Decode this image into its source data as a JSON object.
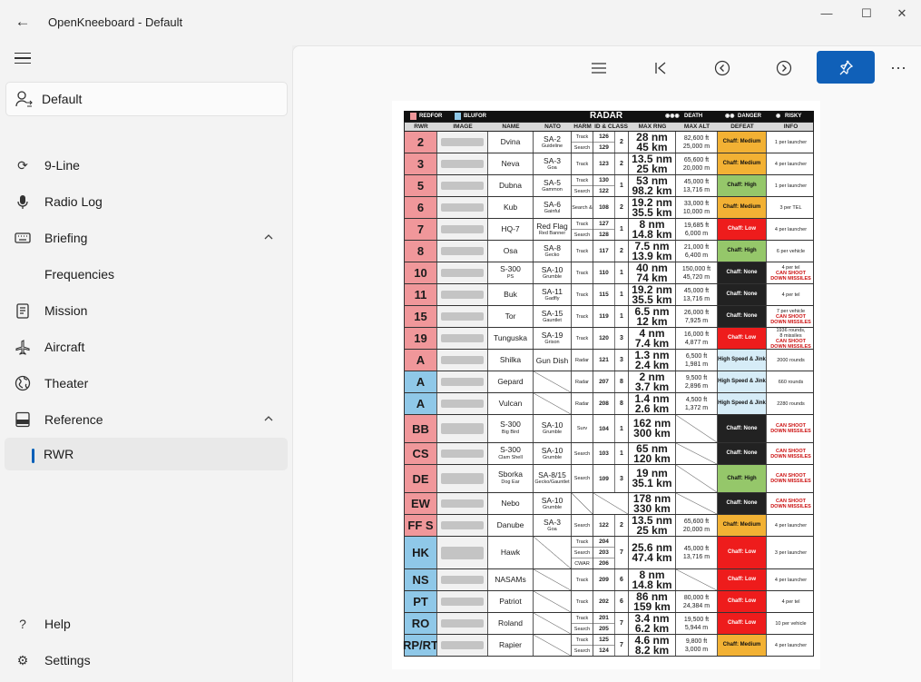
{
  "window": {
    "title": "OpenKneeboard - Default",
    "minimize": "—",
    "maximize": "☐",
    "close": "✕"
  },
  "sidebar": {
    "profile": "Default",
    "items": [
      {
        "label": "9-Line",
        "icon": "refresh-icon"
      },
      {
        "label": "Radio Log",
        "icon": "microphone-icon"
      },
      {
        "label": "Briefing",
        "icon": "keyboard-icon"
      },
      {
        "label": "Frequencies",
        "icon": ""
      },
      {
        "label": "Mission",
        "icon": "clipboard-icon"
      },
      {
        "label": "Aircraft",
        "icon": "airplane-icon"
      },
      {
        "label": "Theater",
        "icon": "globe-icon"
      },
      {
        "label": "Reference",
        "icon": "pdf-icon"
      },
      {
        "label": "RWR",
        "icon": ""
      }
    ],
    "help": "Help",
    "settings": "Settings"
  },
  "toolbar": {
    "more": "···"
  },
  "chart": {
    "title": "RADAR",
    "legend": {
      "redfor": "REDFOR",
      "blufor": "BLUFOR",
      "death": "DEATH",
      "danger": "DANGER",
      "risky": "RISKY"
    },
    "columns": [
      "RWR",
      "IMAGE",
      "NAME",
      "NATO",
      "HARM",
      "ID & CLASS",
      "MAX RNG",
      "MAX ALT",
      "DEFEAT",
      "INFO"
    ],
    "colors": {
      "redfor": "#f0979a",
      "blufor": "#8fc8e8",
      "chaff_medium": "#f2b134",
      "chaff_high": "#95c76a",
      "chaff_low": "#ee1c1c",
      "chaff_none": "#222222",
      "high_speed": "#d6ecf7"
    },
    "rows": [
      {
        "rwr": "2",
        "side": "r",
        "name": "Dvina",
        "name2": "",
        "nato": "SA-2",
        "nato2": "Guideline",
        "modes": [
          "Track",
          "Search"
        ],
        "ids": [
          "126",
          "129"
        ],
        "cls": "2",
        "rng": [
          "28 nm",
          "45 km"
        ],
        "alt": [
          "82,600 ft",
          "25,000 m"
        ],
        "defeat": "Chaff: Medium",
        "dk": "chaff_medium",
        "info": [
          "1 per launcher"
        ],
        "infored": []
      },
      {
        "rwr": "3",
        "side": "r",
        "name": "Neva",
        "name2": "",
        "nato": "SA-3",
        "nato2": "Goa",
        "modes": [
          "Track"
        ],
        "ids": [
          "123"
        ],
        "cls": "2",
        "rng": [
          "13.5 nm",
          "25 km"
        ],
        "alt": [
          "65,600 ft",
          "20,000 m"
        ],
        "defeat": "Chaff: Medium",
        "dk": "chaff_medium",
        "info": [
          "4 per launcher"
        ],
        "infored": []
      },
      {
        "rwr": "5",
        "side": "r",
        "name": "Dubna",
        "name2": "",
        "nato": "SA-5",
        "nato2": "Gammon",
        "modes": [
          "Track",
          "Search"
        ],
        "ids": [
          "130",
          "122"
        ],
        "cls": "1",
        "rng": [
          "53 nm",
          "98.2 km"
        ],
        "alt": [
          "45,000 ft",
          "13,716 m"
        ],
        "defeat": "Chaff: High",
        "dk": "chaff_high",
        "info": [
          "1 per launcher"
        ],
        "infored": []
      },
      {
        "rwr": "6",
        "side": "r",
        "name": "Kub",
        "name2": "",
        "nato": "SA-6",
        "nato2": "Gainful",
        "modes": [
          "Search & Track"
        ],
        "ids": [
          "108"
        ],
        "cls": "2",
        "rng": [
          "19.2 nm",
          "35.5 km"
        ],
        "alt": [
          "33,000 ft",
          "10,000 m"
        ],
        "defeat": "Chaff: Medium",
        "dk": "chaff_medium",
        "info": [
          "3 per TEL"
        ],
        "infored": []
      },
      {
        "rwr": "7",
        "side": "r",
        "name": "HQ-7",
        "name2": "",
        "nato": "Red Flag",
        "nato2": "Red Banner",
        "modes": [
          "Track",
          "Search"
        ],
        "ids": [
          "127",
          "128"
        ],
        "cls": "1",
        "rng": [
          "8 nm",
          "14.8 km"
        ],
        "alt": [
          "19,685 ft",
          "6,000 m"
        ],
        "defeat": "Chaff: Low",
        "dk": "chaff_low",
        "info": [
          "4 per launcher"
        ],
        "infored": []
      },
      {
        "rwr": "8",
        "side": "r",
        "name": "Osa",
        "name2": "",
        "nato": "SA-8",
        "nato2": "Gecko",
        "modes": [
          "Track"
        ],
        "ids": [
          "117"
        ],
        "cls": "2",
        "rng": [
          "7.5 nm",
          "13.9 km"
        ],
        "alt": [
          "21,000 ft",
          "6,400 m"
        ],
        "defeat": "Chaff: High",
        "dk": "chaff_high",
        "info": [
          "6 per vehicle"
        ],
        "infored": []
      },
      {
        "rwr": "10",
        "side": "r",
        "name": "S-300",
        "name2": "PS",
        "nato": "SA-10",
        "nato2": "Grumble",
        "modes": [
          "Track"
        ],
        "ids": [
          "110"
        ],
        "cls": "1",
        "rng": [
          "40 nm",
          "74 km"
        ],
        "alt": [
          "150,000 ft",
          "45,720 m"
        ],
        "defeat": "Chaff: None",
        "dk": "chaff_none",
        "info": [
          "4 per tel"
        ],
        "infored": [
          "CAN SHOOT",
          "DOWN MISSILES"
        ]
      },
      {
        "rwr": "11",
        "side": "r",
        "name": "Buk",
        "name2": "",
        "nato": "SA-11",
        "nato2": "Gadfly",
        "modes": [
          "Track"
        ],
        "ids": [
          "115"
        ],
        "cls": "1",
        "rng": [
          "19.2 nm",
          "35.5 km"
        ],
        "alt": [
          "45,000 ft",
          "13,716 m"
        ],
        "defeat": "Chaff: None",
        "dk": "chaff_none",
        "info": [
          "4 per tel"
        ],
        "infored": []
      },
      {
        "rwr": "15",
        "side": "r",
        "name": "Tor",
        "name2": "",
        "nato": "SA-15",
        "nato2": "Gauntlet",
        "modes": [
          "Track"
        ],
        "ids": [
          "119"
        ],
        "cls": "1",
        "rng": [
          "6.5 nm",
          "12 km"
        ],
        "alt": [
          "26,000 ft",
          "7,925 m"
        ],
        "defeat": "Chaff: None",
        "dk": "chaff_none",
        "info": [
          "7 per vehicle"
        ],
        "infored": [
          "CAN SHOOT",
          "DOWN MISSILES"
        ]
      },
      {
        "rwr": "19",
        "side": "r",
        "name": "Tunguska",
        "name2": "",
        "nato": "SA-19",
        "nato2": "Grison",
        "modes": [
          "Track"
        ],
        "ids": [
          "120"
        ],
        "cls": "3",
        "rng": [
          "4 nm",
          "7.4 km"
        ],
        "alt": [
          "16,000 ft",
          "4,877 m"
        ],
        "defeat": "Chaff: Low",
        "dk": "chaff_low",
        "info": [
          "1936 rounds,",
          "8 missiles"
        ],
        "infored": [
          "CAN SHOOT",
          "DOWN MISSILES"
        ]
      },
      {
        "rwr": "A",
        "side": "r",
        "name": "Shilka",
        "name2": "",
        "nato": "Gun Dish",
        "nato2": "",
        "modes": [
          "Radar"
        ],
        "ids": [
          "121"
        ],
        "cls": "3",
        "rng": [
          "1.3 nm",
          "2.4 km"
        ],
        "alt": [
          "6,500 ft",
          "1,981 m"
        ],
        "defeat": "High Speed & Jink",
        "dk": "high_speed",
        "info": [
          "2000 rounds"
        ],
        "infored": []
      },
      {
        "rwr": "A",
        "side": "b",
        "name": "Gepard",
        "name2": "",
        "nato": "",
        "nato2": "",
        "modes": [
          "Radar"
        ],
        "ids": [
          "207"
        ],
        "cls": "8",
        "rng": [
          "2 nm",
          "3.7 km"
        ],
        "alt": [
          "9,500 ft",
          "2,896 m"
        ],
        "defeat": "High Speed & Jink",
        "dk": "high_speed",
        "info": [
          "660 rounds"
        ],
        "infored": []
      },
      {
        "rwr": "A",
        "side": "b",
        "name": "Vulcan",
        "name2": "",
        "nato": "",
        "nato2": "",
        "modes": [
          "Radar"
        ],
        "ids": [
          "208"
        ],
        "cls": "8",
        "rng": [
          "1.4 nm",
          "2.6 km"
        ],
        "alt": [
          "4,500 ft",
          "1,372 m"
        ],
        "defeat": "High Speed & Jink",
        "dk": "high_speed",
        "info": [
          "2280 rounds"
        ],
        "infored": []
      },
      {
        "rwr": "BB",
        "side": "r",
        "name": "S-300",
        "name2": "Big Bird",
        "nato": "SA-10",
        "nato2": "Grumble",
        "modes": [
          "Surv"
        ],
        "ids": [
          "104"
        ],
        "cls": "1",
        "rng": [
          "162 nm",
          "300 km"
        ],
        "alt": [],
        "defeat": "Chaff: None",
        "dk": "chaff_none",
        "info": [],
        "infored": [
          "CAN SHOOT",
          "DOWN MISSILES"
        ]
      },
      {
        "rwr": "CS",
        "side": "r",
        "name": "S-300",
        "name2": "Clam Shell",
        "nato": "SA-10",
        "nato2": "Grumble",
        "modes": [
          "Search"
        ],
        "ids": [
          "103"
        ],
        "cls": "1",
        "rng": [
          "65 nm",
          "120 km"
        ],
        "alt": [],
        "defeat": "Chaff: None",
        "dk": "chaff_none",
        "info": [],
        "infored": [
          "CAN SHOOT",
          "DOWN MISSILES"
        ]
      },
      {
        "rwr": "DE",
        "side": "r",
        "name": "Sborka",
        "name2": "Dog Ear",
        "nato": "SA-8/15",
        "nato2": "Gecko/Gauntlet",
        "modes": [
          "Search"
        ],
        "ids": [
          "109"
        ],
        "cls": "3",
        "rng": [
          "19 nm",
          "35.1 km"
        ],
        "alt": [],
        "defeat": "Chaff: High",
        "dk": "chaff_high",
        "info": [],
        "infored": [
          "CAN SHOOT",
          "DOWN MISSILES"
        ]
      },
      {
        "rwr": "EW",
        "side": "r",
        "name": "Nebo",
        "name2": "",
        "nato": "SA-10",
        "nato2": "Grumble",
        "modes": [],
        "ids": [],
        "cls": "",
        "rng": [
          "178 nm",
          "330 km"
        ],
        "alt": [],
        "defeat": "Chaff: None",
        "dk": "chaff_none",
        "info": [],
        "infored": [
          "CAN SHOOT",
          "DOWN MISSILES"
        ]
      },
      {
        "rwr": "FF S",
        "side": "r",
        "name": "Danube",
        "name2": "",
        "nato": "SA-3",
        "nato2": "Goa",
        "modes": [
          "Search"
        ],
        "ids": [
          "122"
        ],
        "cls": "2",
        "rng": [
          "13.5 nm",
          "25 km"
        ],
        "alt": [
          "65,600 ft",
          "20,000 m"
        ],
        "defeat": "Chaff: Medium",
        "dk": "chaff_medium",
        "info": [
          "4 per launcher"
        ],
        "infored": []
      },
      {
        "rwr": "HK",
        "side": "b",
        "name": "Hawk",
        "name2": "",
        "nato": "",
        "nato2": "",
        "modes": [
          "Track",
          "Search",
          "CWAR"
        ],
        "ids": [
          "204",
          "203",
          "206"
        ],
        "cls": "7",
        "rng": [
          "25.6 nm",
          "47.4 km"
        ],
        "alt": [
          "45,000 ft",
          "13,716 m"
        ],
        "defeat": "Chaff: Low",
        "dk": "chaff_low",
        "info": [
          "3 per launcher"
        ],
        "infored": []
      },
      {
        "rwr": "NS",
        "side": "b",
        "name": "NASAMs",
        "name2": "",
        "nato": "",
        "nato2": "",
        "modes": [
          "Track"
        ],
        "ids": [
          "209"
        ],
        "cls": "6",
        "rng": [
          "8 nm",
          "14.8 km"
        ],
        "alt": [],
        "defeat": "Chaff: Low",
        "dk": "chaff_low",
        "info": [
          "4 per launcher"
        ],
        "infored": []
      },
      {
        "rwr": "PT",
        "side": "b",
        "name": "Patriot",
        "name2": "",
        "nato": "",
        "nato2": "",
        "modes": [
          "Track"
        ],
        "ids": [
          "202"
        ],
        "cls": "6",
        "rng": [
          "86 nm",
          "159 km"
        ],
        "alt": [
          "80,000 ft",
          "24,384 m"
        ],
        "defeat": "Chaff: Low",
        "dk": "chaff_low",
        "info": [
          "4 per tel"
        ],
        "infored": []
      },
      {
        "rwr": "RO",
        "side": "b",
        "name": "Roland",
        "name2": "",
        "nato": "",
        "nato2": "",
        "modes": [
          "Track",
          "Search"
        ],
        "ids": [
          "201",
          "205"
        ],
        "cls": "7",
        "rng": [
          "3.4 nm",
          "6.2 km"
        ],
        "alt": [
          "19,500 ft",
          "5,944 m"
        ],
        "defeat": "Chaff: Low",
        "dk": "chaff_low",
        "info": [
          "10 per vehicle"
        ],
        "infored": []
      },
      {
        "rwr": "RP/RT",
        "side": "b",
        "name": "Rapier",
        "name2": "",
        "nato": "",
        "nato2": "",
        "modes": [
          "Track",
          "Search"
        ],
        "ids": [
          "125",
          "124"
        ],
        "cls": "7",
        "rng": [
          "4.6 nm",
          "8.2 km"
        ],
        "alt": [
          "9,800 ft",
          "3,000 m"
        ],
        "defeat": "Chaff: Medium",
        "dk": "chaff_medium",
        "info": [
          "4 per launcher"
        ],
        "infored": []
      }
    ]
  }
}
